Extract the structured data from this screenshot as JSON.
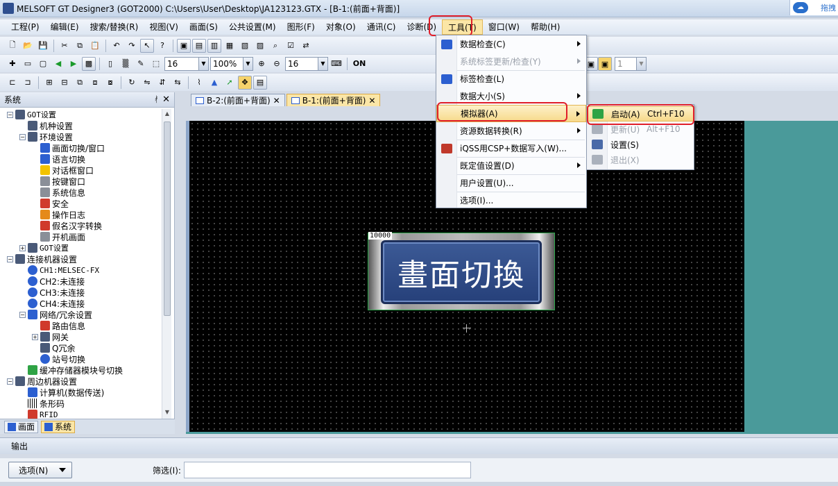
{
  "window": {
    "title": "MELSOFT GT Designer3 (GOT2000) C:\\Users\\User\\Desktop\\JA123123.GTX - [B-1:(前面+背面)]",
    "tray_label": "拖拽"
  },
  "menubar": {
    "items": [
      "工程(P)",
      "编辑(E)",
      "搜索/替换(R)",
      "视图(V)",
      "画面(S)",
      "公共设置(M)",
      "图形(F)",
      "对象(O)",
      "通讯(C)",
      "诊断(D)",
      "工具(T)",
      "窗口(W)",
      "帮助(H)"
    ],
    "active": "工具(T)"
  },
  "toolbar": {
    "font_size_1": "16",
    "zoom": "100%",
    "font_size_2": "16",
    "on_label": "ON",
    "layer_value": "1"
  },
  "system_panel": {
    "title": "系统",
    "pin": "ᚯ",
    "close": "✕",
    "tree": [
      {
        "label": "GOT设置",
        "level": 0,
        "exp": "−",
        "icon": "got",
        "mono": true
      },
      {
        "label": "机种设置",
        "level": 1,
        "icon": "got"
      },
      {
        "label": "环境设置",
        "level": 1,
        "exp": "−",
        "icon": "got"
      },
      {
        "label": "画面切换/窗口",
        "level": 2,
        "icon": "blue"
      },
      {
        "label": "语言切换",
        "level": 2,
        "icon": "blue"
      },
      {
        "label": "对话框窗口",
        "level": 2,
        "icon": "warn"
      },
      {
        "label": "按键窗口",
        "level": 2,
        "icon": "gray"
      },
      {
        "label": "系统信息",
        "level": 2,
        "icon": "gray"
      },
      {
        "label": "安全",
        "level": 2,
        "icon": "red"
      },
      {
        "label": "操作日志",
        "level": 2,
        "icon": "orange"
      },
      {
        "label": "假名汉字转换",
        "level": 2,
        "icon": "red"
      },
      {
        "label": "开机画面",
        "level": 2,
        "icon": "gray"
      },
      {
        "label": "GOT设置",
        "level": 1,
        "exp": "+",
        "icon": "got",
        "mono": true
      },
      {
        "label": "连接机器设置",
        "level": 0,
        "exp": "−",
        "icon": "got"
      },
      {
        "label": "CH1:MELSEC-FX",
        "level": 1,
        "icon": "ch",
        "mono": true
      },
      {
        "label": "CH2:未连接",
        "level": 1,
        "icon": "ch"
      },
      {
        "label": "CH3:未连接",
        "level": 1,
        "icon": "ch"
      },
      {
        "label": "CH4:未连接",
        "level": 1,
        "icon": "ch"
      },
      {
        "label": "网络/冗余设置",
        "level": 1,
        "exp": "−",
        "icon": "blue"
      },
      {
        "label": "路由信息",
        "level": 2,
        "icon": "red"
      },
      {
        "label": "网关",
        "level": 2,
        "exp": "+",
        "icon": "got"
      },
      {
        "label": "Q冗余",
        "level": 2,
        "icon": "got"
      },
      {
        "label": "站号切换",
        "level": 2,
        "icon": "ch"
      },
      {
        "label": "缓冲存储器模块号切换",
        "level": 1,
        "icon": "green"
      },
      {
        "label": "周边机器设置",
        "level": 0,
        "exp": "−",
        "icon": "got"
      },
      {
        "label": "计算机(数据传送)",
        "level": 1,
        "icon": "blue"
      },
      {
        "label": "条形码",
        "level": 1,
        "icon": "bar"
      },
      {
        "label": "RFID",
        "level": 1,
        "icon": "red",
        "mono": true
      }
    ],
    "tabs": [
      "画面",
      "系统"
    ],
    "active_tab": "系统"
  },
  "doc_tabs": [
    {
      "label": "B-2:(前面+背面)",
      "close": "✕"
    },
    {
      "label": "B-1:(前面+背面)",
      "close": "✕"
    }
  ],
  "canvas": {
    "button_id": "10000",
    "button_text": "畫面切換"
  },
  "tools_menu": {
    "items": [
      {
        "label": "数据检查(C)",
        "sub": true,
        "icon": "data"
      },
      {
        "label": "系统标签更新/检查(Y)",
        "sub": true,
        "disabled": true
      },
      {
        "label": "标签检查(L)",
        "icon": "label"
      },
      {
        "label": "数据大小(S)",
        "sub": true
      },
      {
        "label": "模拟器(A)",
        "sub": true,
        "hover": true
      },
      {
        "label": "资源数据转换(R)",
        "sub": true
      },
      {
        "label": "iQSS用CSP+数据写入(W)...",
        "icon": "iq"
      },
      {
        "label": "既定值设置(D)",
        "sub": true
      },
      {
        "label": "用户设置(U)..."
      },
      {
        "label": "选项(I)..."
      }
    ]
  },
  "simulator_menu": {
    "items": [
      {
        "label": "启动(A)",
        "shortcut": "Ctrl+F10",
        "hover": true,
        "icon": "start"
      },
      {
        "label": "更新(U)",
        "shortcut": "Alt+F10",
        "disabled": true,
        "icon": "update"
      },
      {
        "label": "设置(S)",
        "icon": "settings"
      },
      {
        "label": "退出(X)",
        "disabled": true,
        "icon": "exit"
      }
    ]
  },
  "output": {
    "title": "输出",
    "options_label": "选项(N)",
    "filter_label": "筛选(I):",
    "filter_value": ""
  },
  "colors": {
    "highlight": "#e01e2a",
    "canvas_bg": "#000000",
    "workspace_bg": "#4a9a9a",
    "button_face": "#3c5a96"
  }
}
